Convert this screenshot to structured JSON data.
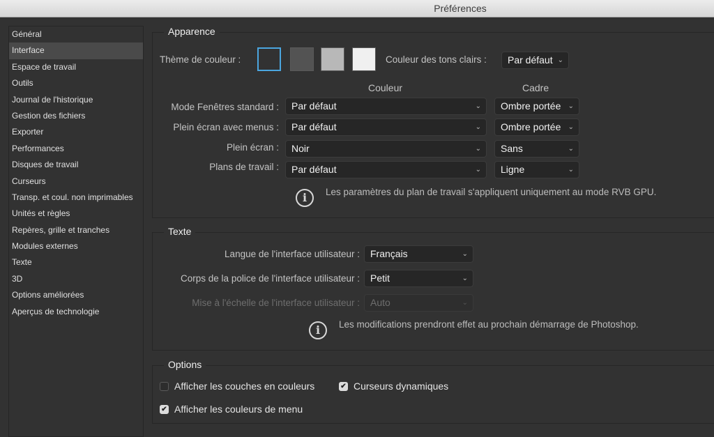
{
  "window": {
    "title": "Préférences"
  },
  "sidebar": {
    "selected_index": 1,
    "items": [
      {
        "label": "Général"
      },
      {
        "label": "Interface"
      },
      {
        "label": "Espace de travail"
      },
      {
        "label": "Outils"
      },
      {
        "label": "Journal de l'historique"
      },
      {
        "label": "Gestion des fichiers"
      },
      {
        "label": "Exporter"
      },
      {
        "label": "Performances"
      },
      {
        "label": "Disques de travail"
      },
      {
        "label": "Curseurs"
      },
      {
        "label": "Transp. et coul. non imprimables"
      },
      {
        "label": "Unités et règles"
      },
      {
        "label": "Repères, grille et tranches"
      },
      {
        "label": "Modules externes"
      },
      {
        "label": "Texte"
      },
      {
        "label": "3D"
      },
      {
        "label": "Options améliorées"
      },
      {
        "label": "Aperçus de technologie"
      }
    ]
  },
  "appearance": {
    "title": "Apparence",
    "theme_label": "Thème de couleur :",
    "themes": [
      {
        "name": "darkest",
        "color": "#323232",
        "selected": true
      },
      {
        "name": "dark",
        "color": "#535353",
        "selected": false
      },
      {
        "name": "medium",
        "color": "#b8b8b8",
        "selected": false
      },
      {
        "name": "light",
        "color": "#f0f0f0",
        "selected": false
      }
    ],
    "selected_border_color": "#4ba6e0",
    "highlight_label": "Couleur des tons clairs :",
    "highlight_value": "Par défaut",
    "col_color": "Couleur",
    "col_frame": "Cadre",
    "rows": [
      {
        "label": "Mode Fenêtres standard :",
        "color": "Par défaut",
        "frame": "Ombre portée"
      },
      {
        "label": "Plein écran avec menus :",
        "color": "Par défaut",
        "frame": "Ombre portée"
      },
      {
        "label": "Plein écran :",
        "color": "Noir",
        "frame": "Sans"
      },
      {
        "label": "Plans de travail :",
        "color": "Par défaut",
        "frame": "Ligne"
      }
    ],
    "info": "Les paramètres du plan de travail s'appliquent uniquement au mode RVB GPU."
  },
  "text": {
    "title": "Texte",
    "language_label": "Langue de l'interface utilisateur :",
    "language_value": "Français",
    "font_size_label": "Corps de la police de l'interface utilisateur :",
    "font_size_value": "Petit",
    "scale_label": "Mise à l'échelle de l'interface utilisateur :",
    "scale_value": "Auto",
    "info": "Les modifications prendront effet au prochain démarrage de Photoshop."
  },
  "options": {
    "title": "Options",
    "items": [
      {
        "label": "Afficher les couches en couleurs",
        "checked": false
      },
      {
        "label": "Curseurs dynamiques",
        "checked": true
      },
      {
        "label": "Afficher les couleurs de menu",
        "checked": true
      }
    ]
  },
  "icons": {
    "chevron": "⌄",
    "info": "i",
    "check": "✔"
  }
}
